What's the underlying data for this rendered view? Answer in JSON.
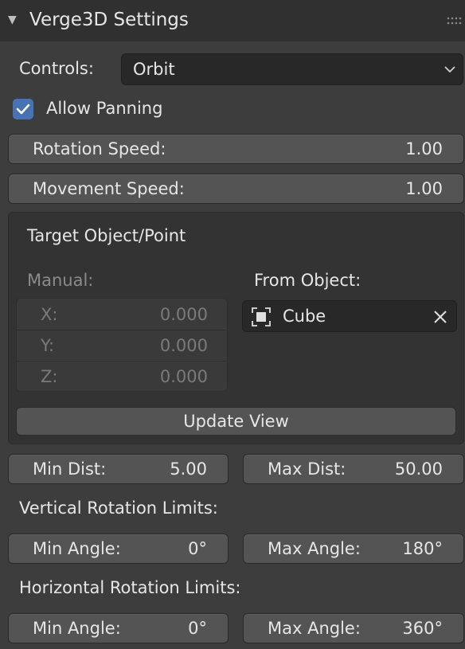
{
  "panel": {
    "title": "Verge3D Settings"
  },
  "controls": {
    "label": "Controls:",
    "value": "Orbit"
  },
  "allow_panning": {
    "label": "Allow Panning",
    "checked": true
  },
  "rotation_speed": {
    "label": "Rotation Speed:",
    "value": "1.00"
  },
  "movement_speed": {
    "label": "Movement Speed:",
    "value": "1.00"
  },
  "target": {
    "title": "Target Object/Point",
    "manual_label": "Manual:",
    "x_label": "X:",
    "x_value": "0.000",
    "y_label": "Y:",
    "y_value": "0.000",
    "z_label": "Z:",
    "z_value": "0.000",
    "from_object_label": "From Object:",
    "object_value": "Cube",
    "update_button": "Update View"
  },
  "distance": {
    "min_label": "Min Dist:",
    "min_value": "5.00",
    "max_label": "Max Dist:",
    "max_value": "50.00"
  },
  "vertical": {
    "title": "Vertical Rotation Limits:",
    "min_label": "Min Angle:",
    "min_value": "0°",
    "max_label": "Max Angle:",
    "max_value": "180°"
  },
  "horizontal": {
    "title": "Horizontal Rotation Limits:",
    "min_label": "Min Angle:",
    "min_value": "0°",
    "max_label": "Max Angle:",
    "max_value": "360°"
  },
  "colors": {
    "checkbox": "#4772b3",
    "background": "#3d3d3d",
    "field": "#545454"
  }
}
